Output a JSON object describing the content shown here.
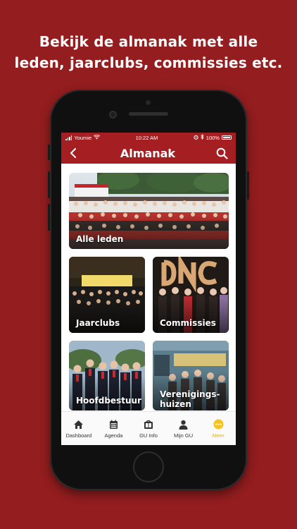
{
  "promo": {
    "line1": "Bekijk de almanak met alle",
    "line2": "leden, jaarclubs, commissies etc."
  },
  "status": {
    "carrier": "Youmie",
    "time": "10:22 AM",
    "battery": "100%"
  },
  "header": {
    "title": "Almanak",
    "back_icon": "chevron-left-icon",
    "search_icon": "search-icon"
  },
  "cards": [
    {
      "label": "Alle leden"
    },
    {
      "label": "Jaarclubs"
    },
    {
      "label": "Commissies"
    },
    {
      "label": "Hoofdbestuur"
    },
    {
      "label_line1": "Verenigings-",
      "label_line2": "huizen"
    }
  ],
  "tabs": [
    {
      "label": "Dashboard",
      "icon": "home-icon"
    },
    {
      "label": "Agenda",
      "icon": "calendar-icon"
    },
    {
      "label": "GU Info",
      "icon": "info-book-icon"
    },
    {
      "label": "Mijn GU",
      "icon": "user-icon"
    },
    {
      "label": "Meer",
      "icon": "more-dots-icon",
      "active": true
    }
  ],
  "colors": {
    "background": "#931d1f",
    "brand_red": "#a51e22",
    "active_tab": "#e0b21a"
  }
}
